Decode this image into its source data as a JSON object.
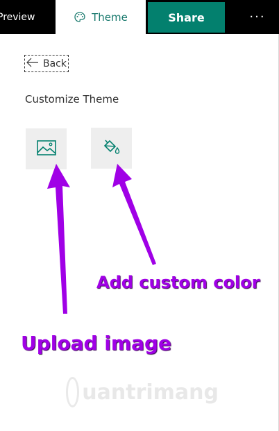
{
  "topbar": {
    "preview_label": "Preview",
    "theme_label": "Theme",
    "share_label": "Share",
    "more_label": "···",
    "theme_icon": "palette-icon"
  },
  "panel": {
    "back_label": "Back",
    "back_icon": "arrow-left-icon",
    "section_title": "Customize Theme",
    "tiles": [
      {
        "icon": "image-icon"
      },
      {
        "icon": "paint-bucket-icon"
      }
    ]
  },
  "annotations": {
    "add_custom_color": "Add custom color",
    "upload_image": "Upload image",
    "color": "#a000e6"
  },
  "watermark": {
    "text": "uantrimang"
  },
  "colors": {
    "accent": "#03806e",
    "theme_text": "#1a7a6e",
    "topbar": "#000000",
    "tile_bg": "#eeeeee"
  }
}
